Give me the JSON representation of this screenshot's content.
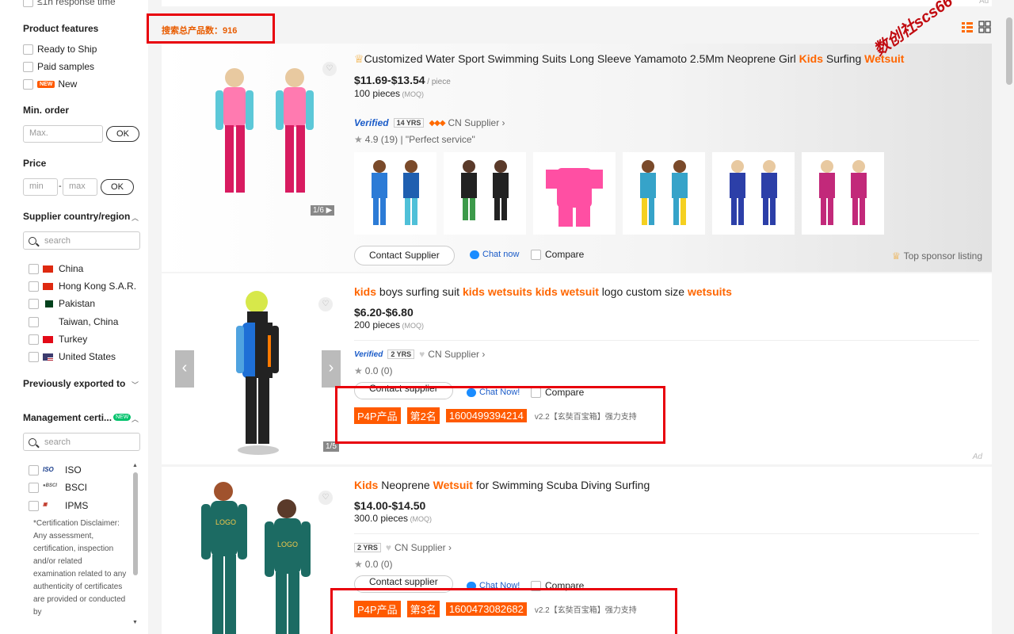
{
  "sidebar": {
    "top_partial": "≤1h response time",
    "product_features": {
      "title": "Product features",
      "items": [
        "Ready to Ship",
        "Paid samples",
        "New"
      ],
      "new_badge": "NEW"
    },
    "min_order": {
      "title": "Min. order",
      "placeholder": "Max.",
      "ok": "OK"
    },
    "price": {
      "title": "Price",
      "min_placeholder": "min",
      "max_placeholder": "max",
      "dash": "-",
      "ok": "OK"
    },
    "supplier_country": {
      "title": "Supplier country/region",
      "search_placeholder": "search",
      "items": [
        "China",
        "Hong Kong S.A.R.",
        "Pakistan",
        "Taiwan, China",
        "Turkey",
        "United States"
      ]
    },
    "previously_exported": {
      "title": "Previously exported to"
    },
    "management_cert": {
      "title": "Management certi...",
      "new_badge": "NEW",
      "search_placeholder": "search",
      "items": [
        "ISO",
        "BSCI",
        "IPMS"
      ],
      "disclaimer": "*Certification Disclaimer: Any assessment, certification, inspection and/or related examination related to any authenticity of certificates are provided or conducted by"
    }
  },
  "main": {
    "total_count_label": "搜索总产品数：916",
    "watermark": "数创社scs66",
    "ad_top": "Ad",
    "products": [
      {
        "title_parts": [
          {
            "t": "Customized Water Sport Swimming Suits Long Sleeve Yamamoto 2.5Mm Neoprene Girl ",
            "kw": false
          },
          {
            "t": "Kids",
            "kw": true
          },
          {
            "t": " Surfing ",
            "kw": false
          },
          {
            "t": "Wetsuit",
            "kw": true
          }
        ],
        "price": "$11.69-$13.54",
        "price_unit": " / piece",
        "moq": "100 pieces",
        "moq_label": " (MOQ)",
        "verified": "Verified",
        "years": "14 YRS",
        "supplier_type": "CN Supplier ›",
        "rating": "4.9 (19)",
        "review": "\"Perfect service\"",
        "pager": "1/6 ▶",
        "contact": "Contact Supplier",
        "chat": "Chat now",
        "compare": "Compare",
        "sponsor": "Top sponsor listing"
      },
      {
        "title_parts": [
          {
            "t": "kids",
            "kw": true
          },
          {
            "t": " boys surfing suit ",
            "kw": false
          },
          {
            "t": "kids wetsuits kids wetsuit",
            "kw": true
          },
          {
            "t": " logo custom size ",
            "kw": false
          },
          {
            "t": "wetsuits",
            "kw": true
          }
        ],
        "price": "$6.20-$6.80",
        "moq": "200 pieces",
        "moq_label": " (MOQ)",
        "verified": "Verified",
        "years": "2 YRS",
        "supplier_type": "CN Supplier ›",
        "rating": "0.0 (0)",
        "pager": "1/5",
        "contact": "Contact supplier",
        "chat": "Chat Now!",
        "compare": "Compare",
        "ad": "Ad",
        "p4p": [
          "P4P产品",
          "第2名",
          "1600499394214"
        ],
        "p4p_note": "v2.2【玄奘百宝箱】强力支持"
      },
      {
        "title_parts": [
          {
            "t": "Kids",
            "kw": true
          },
          {
            "t": " Neoprene ",
            "kw": false
          },
          {
            "t": "Wetsuit",
            "kw": true
          },
          {
            "t": " for Swimming Scuba Diving Surfing",
            "kw": false
          }
        ],
        "price": "$14.00-$14.50",
        "moq": "300.0 pieces",
        "moq_label": " (MOQ)",
        "years": "2 YRS",
        "supplier_type": "CN Supplier ›",
        "rating": "0.0 (0)",
        "contact": "Contact supplier",
        "chat": "Chat Now!",
        "compare": "Compare",
        "p4p": [
          "P4P产品",
          "第3名",
          "1600473082682"
        ],
        "p4p_note": "v2.2【玄奘百宝箱】强力支持"
      }
    ]
  },
  "colors": {
    "keyword": "#ff6600",
    "p4p_tag": "#ff5a00",
    "highlight_box": "#e8000b",
    "verified": "#1a5bc8"
  }
}
